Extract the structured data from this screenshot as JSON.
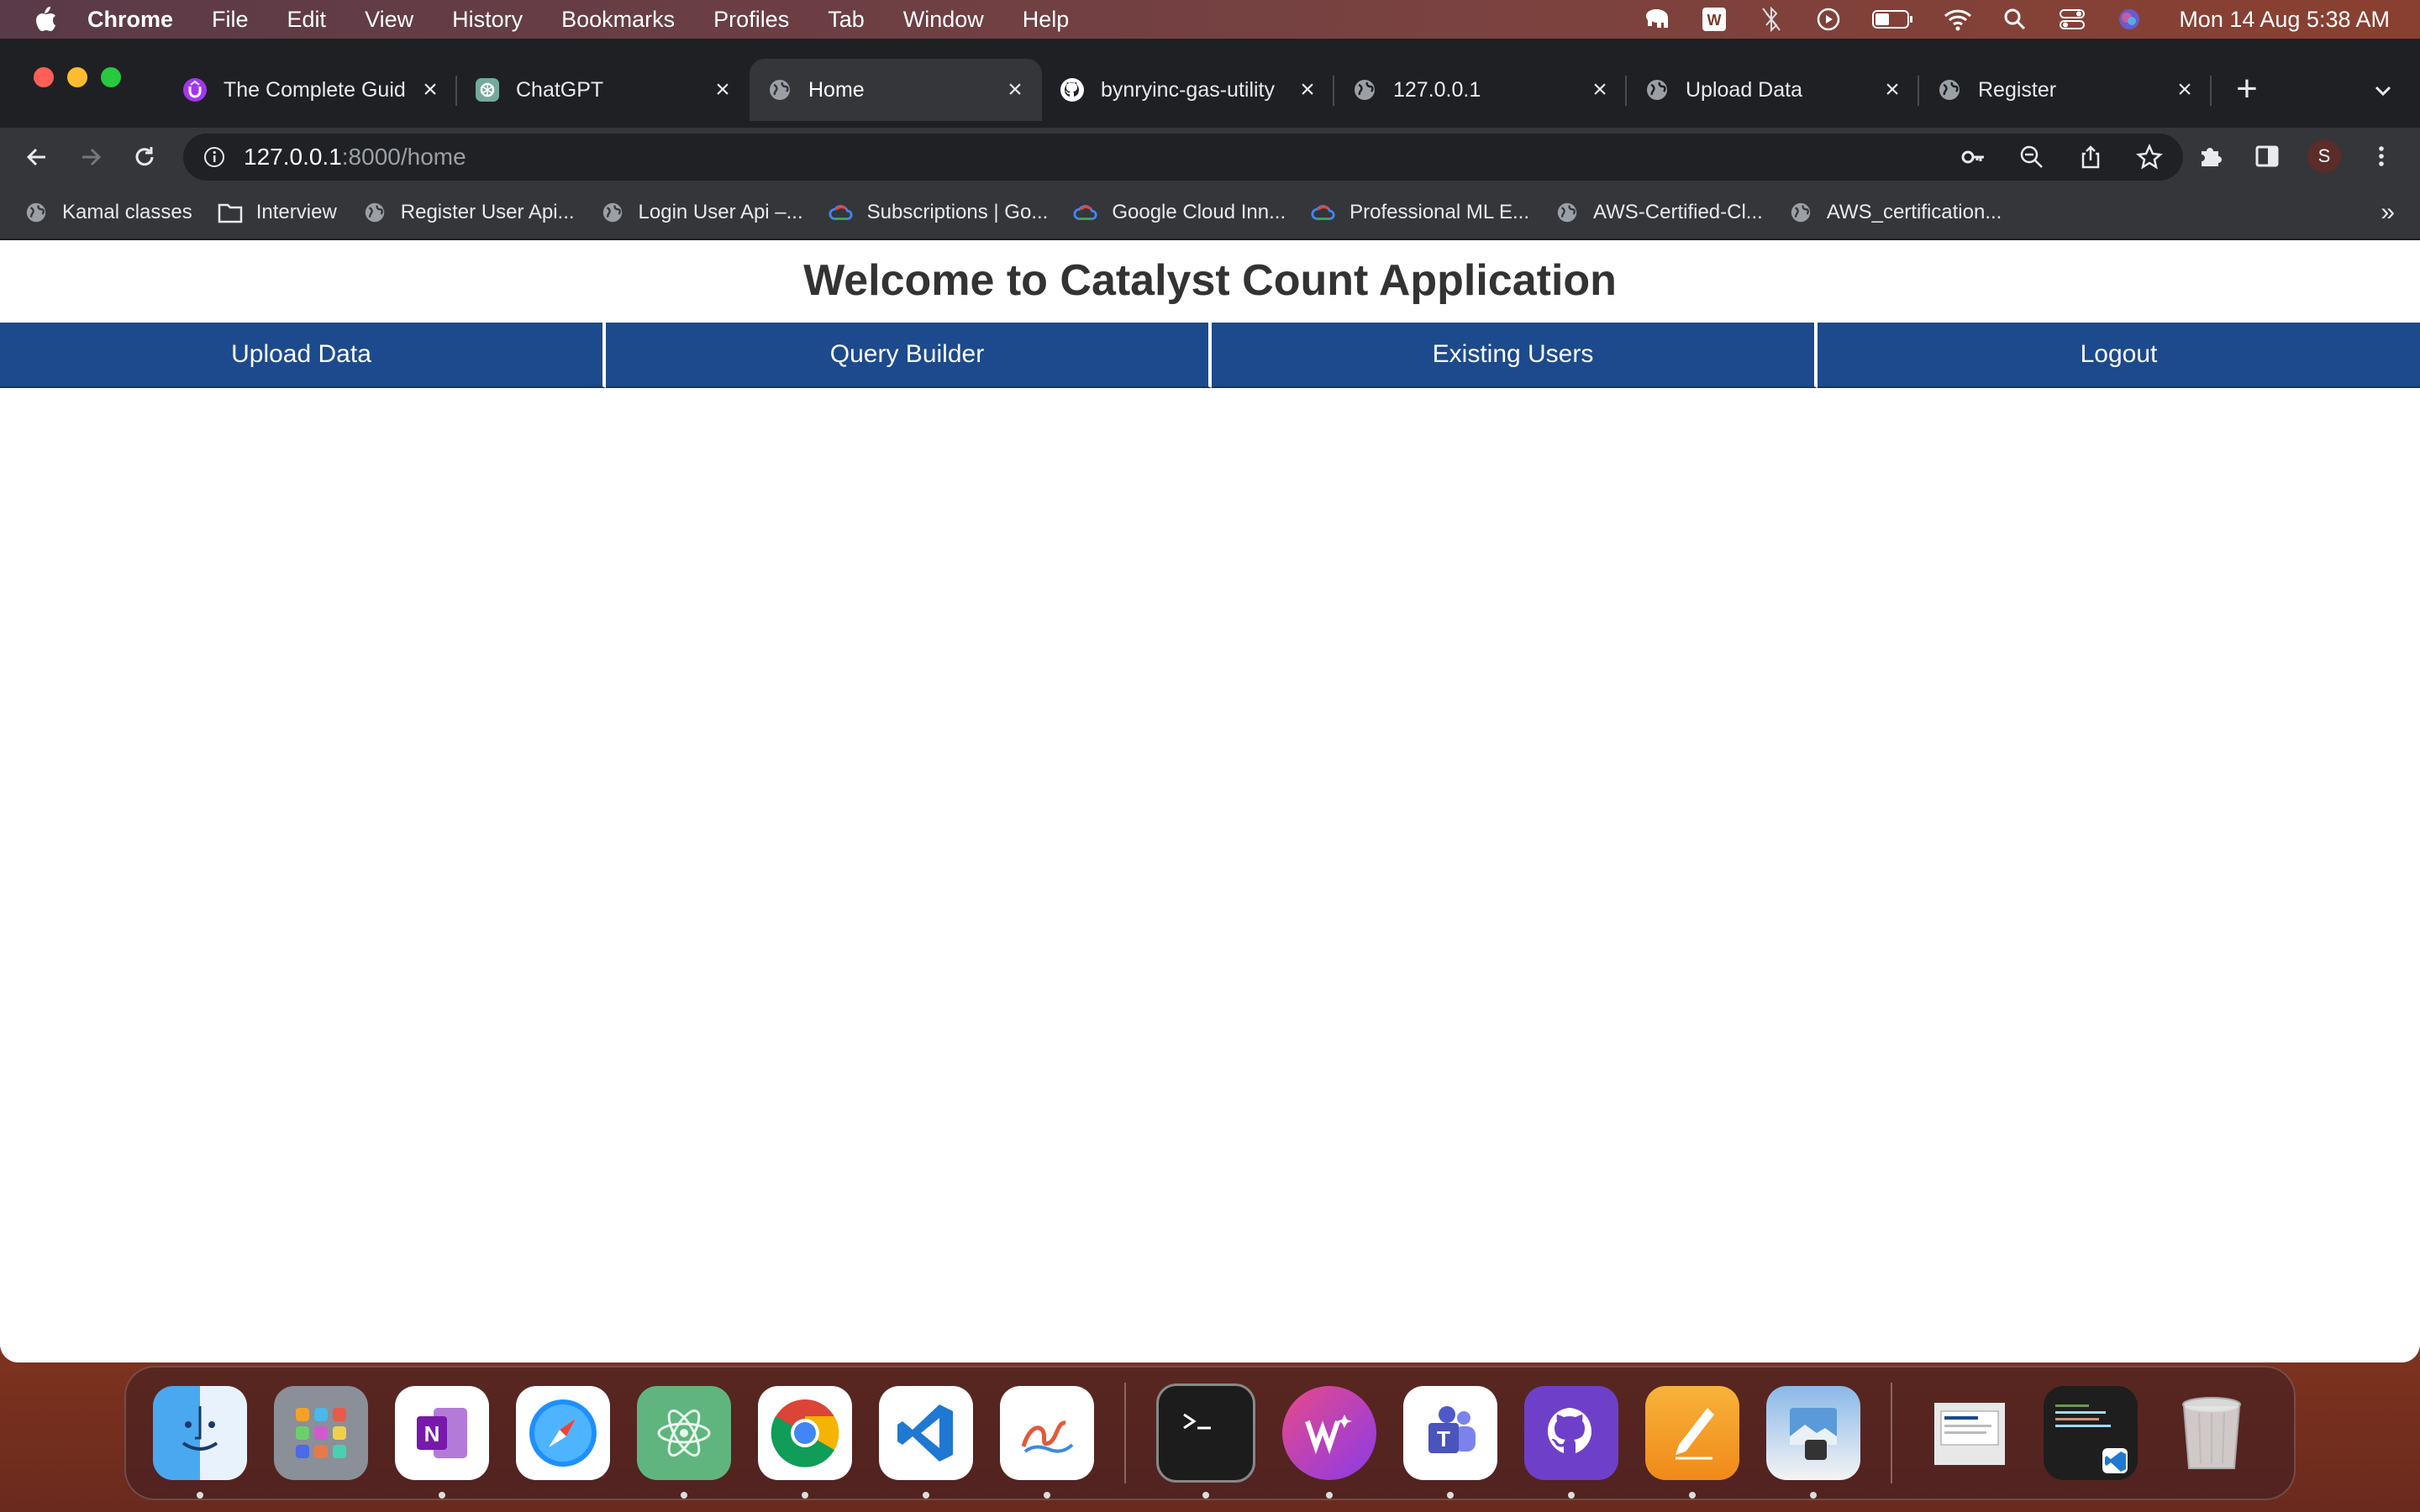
{
  "menubar": {
    "app_name": "Chrome",
    "items": [
      "File",
      "Edit",
      "View",
      "History",
      "Bookmarks",
      "Profiles",
      "Tab",
      "Window",
      "Help"
    ],
    "clock": "Mon 14 Aug  5:38 AM"
  },
  "tabs": [
    {
      "title": "The Complete Guid",
      "icon": "udemy-icon",
      "active": false
    },
    {
      "title": "ChatGPT",
      "icon": "chatgpt-icon",
      "active": false
    },
    {
      "title": "Home",
      "icon": "globe-icon",
      "active": true
    },
    {
      "title": "bynryinc-gas-utility",
      "icon": "github-icon",
      "active": false
    },
    {
      "title": "127.0.0.1",
      "icon": "globe-icon",
      "active": false
    },
    {
      "title": "Upload Data",
      "icon": "globe-icon",
      "active": false
    },
    {
      "title": "Register",
      "icon": "globe-icon",
      "active": false
    }
  ],
  "address": {
    "host": "127.0.0.1",
    "rest": ":8000/home"
  },
  "profile_initial": "S",
  "bookmarks": [
    {
      "label": "Kamal classes",
      "icon": "globe-icon"
    },
    {
      "label": "Interview",
      "icon": "folder-icon"
    },
    {
      "label": "Register User Api...",
      "icon": "globe-icon"
    },
    {
      "label": "Login User Api –...",
      "icon": "globe-icon"
    },
    {
      "label": "Subscriptions | Go...",
      "icon": "google-cloud-icon"
    },
    {
      "label": "Google Cloud Inn...",
      "icon": "google-cloud-icon"
    },
    {
      "label": "Professional ML E...",
      "icon": "google-cloud-icon"
    },
    {
      "label": "AWS-Certified-Cl...",
      "icon": "globe-icon"
    },
    {
      "label": "AWS_certification...",
      "icon": "globe-icon"
    }
  ],
  "bookmarks_more": "»",
  "page": {
    "title": "Welcome to Catalyst Count Application",
    "nav": [
      "Upload Data",
      "Query Builder",
      "Existing Users",
      "Logout"
    ],
    "nav_color": "#1c4a8c"
  },
  "dock": [
    "finder-icon",
    "launchpad-icon",
    "onenote-icon",
    "safari-icon",
    "atom-icon",
    "chrome-icon",
    "vscode-icon",
    "freeform-icon",
    "terminal-icon",
    "wps-icon",
    "teams-icon",
    "github-desktop-icon",
    "pages-icon",
    "preview-icon",
    "document-thumbnail-icon",
    "vscode-window-thumbnail-icon",
    "trash-icon"
  ]
}
